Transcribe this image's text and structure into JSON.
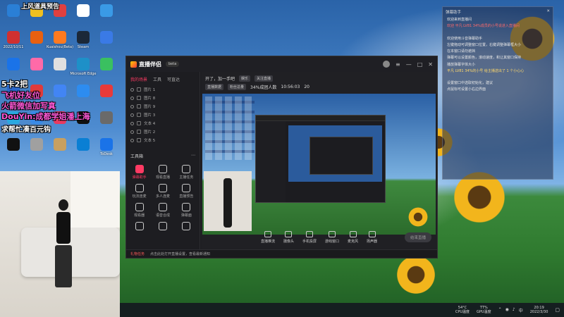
{
  "desktop": {
    "icons": [
      {
        "label": "",
        "color": "#2a7fd6"
      },
      {
        "label": "",
        "color": "#f0c020"
      },
      {
        "label": "",
        "color": "#e04040"
      },
      {
        "label": "",
        "color": "#ffffff"
      },
      {
        "label": "",
        "color": "#3a9ae6"
      },
      {
        "label": "2022/10/11",
        "color": "#d03030"
      },
      {
        "label": "",
        "color": "#e86010"
      },
      {
        "label": "Kuaishou(Beta)",
        "color": "#ff7a20"
      },
      {
        "label": "Steam",
        "color": "#1b2838"
      },
      {
        "label": "",
        "color": "#3a7ae6"
      },
      {
        "label": "",
        "color": "#1a73e8"
      },
      {
        "label": "",
        "color": "#ff6aa8"
      },
      {
        "label": "",
        "color": "#e0e0e0"
      },
      {
        "label": "Microsoft Edge",
        "color": "#1e90c8"
      },
      {
        "label": "",
        "color": "#3ac060"
      },
      {
        "label": "",
        "color": "#2a66c9"
      },
      {
        "label": "",
        "color": "#e03a3a"
      },
      {
        "label": "",
        "color": "#4285f4"
      },
      {
        "label": "",
        "color": "#2d8cf0"
      },
      {
        "label": "",
        "color": "#e83a3a"
      },
      {
        "label": "",
        "color": "#2aa9e0"
      },
      {
        "label": "",
        "color": "#3a8ae6"
      },
      {
        "label": "",
        "color": "#e83a60"
      },
      {
        "label": "",
        "color": "#101010"
      },
      {
        "label": "",
        "color": "#6a6a6a"
      },
      {
        "label": "",
        "color": "#111111"
      },
      {
        "label": "",
        "color": "#a0a0a0"
      },
      {
        "label": "",
        "color": "#c8a060"
      },
      {
        "label": "",
        "color": "#0a7fd4"
      },
      {
        "label": "ToDesk",
        "color": "#1a73e8"
      }
    ],
    "overlay_lines": [
      {
        "text": "5卡2把",
        "color": "#ffffff"
      },
      {
        "text": "飞机好友位",
        "color": "#ff5ad8"
      },
      {
        "text": "火箭微信加写真",
        "color": "#ff5ad8"
      },
      {
        "text": "DouYin:成都学姐潘上海",
        "color": "#ff5ad8"
      },
      {
        "text": "求帮忙凑百元钩",
        "color": "#ffffff"
      }
    ],
    "top_overlay": "上风道具预告"
  },
  "app": {
    "title": "直播伴侣",
    "version": "beta",
    "tabs": [
      "我的场景",
      "工具",
      "可直达"
    ],
    "scenes": [
      "图片 1",
      "图片 8",
      "图片 9",
      "图片 3",
      "文本 4",
      "图片 2",
      "文本 5"
    ],
    "tools_title": "工具箱",
    "tools": [
      {
        "label": "弹幕助手",
        "hot": true
      },
      {
        "label": "观看直播",
        "hot": false
      },
      {
        "label": "主播任务",
        "hot": false
      },
      {
        "label": "玩法连麦",
        "hot": false
      },
      {
        "label": "多人连麦",
        "hot": false
      },
      {
        "label": "直播预告",
        "hot": false
      },
      {
        "label": "观看器",
        "hot": false
      },
      {
        "label": "语音合成",
        "hot": false
      },
      {
        "label": "弹幕面",
        "hot": false
      },
      {
        "label": "",
        "hot": false
      },
      {
        "label": "",
        "hot": false
      },
      {
        "label": "",
        "hot": false
      }
    ],
    "topbar": {
      "greeting": "开了，加一手吧",
      "tag": "娱乐",
      "room": "关注直播",
      "stats": [
        "直播数据",
        "粉丝总量",
        "34%成团人数",
        "10:56:03",
        "20"
      ]
    },
    "bottom_actions": [
      "直播推流",
      "摄像头",
      "手机投屏",
      "游戏窗口",
      "麦克风",
      "扬声器"
    ],
    "start_label": "结束直播",
    "status": {
      "prefix": "礼物任务",
      "text": "点击此处打开直播设置，查看最新通知"
    }
  },
  "chat": {
    "title": "弹幕助手",
    "lines": [
      {
        "text": "欢迎来到直播间",
        "kind": "normal"
      },
      {
        "text": "欢迎 平凡 LV81 34%成员的小号说进入直播间",
        "kind": "hl"
      },
      {
        "text": "",
        "kind": "gap"
      },
      {
        "text": "欢迎使用斗音弹幕助手",
        "kind": "normal"
      },
      {
        "text": "左键拖动可调整窗口位置，右键调整弹幕框大小",
        "kind": "normal"
      },
      {
        "text": "在本窗口请勿遮挡",
        "kind": "normal"
      },
      {
        "text": "弹幕可以设置颜色，滚动速度，和让其窗口保持",
        "kind": "normal"
      },
      {
        "text": "播放弹幕字体大小",
        "kind": "normal"
      },
      {
        "text": "平凡 LV81 34%的小号 给主播送出了 1 个小心心",
        "kind": "y"
      },
      {
        "text": "",
        "kind": "gap"
      },
      {
        "text": "设置窗口中选取初始化，建议",
        "kind": "normal"
      },
      {
        "text": "点鼠标可设置小右边界面",
        "kind": "normal"
      }
    ]
  },
  "taskbar": {
    "cpu": "CPU温度",
    "cpu_val": "54°C",
    "gpu": "GPU温度",
    "gpu_val": "TT%",
    "time": "20:19",
    "date": "2022/3/30"
  }
}
